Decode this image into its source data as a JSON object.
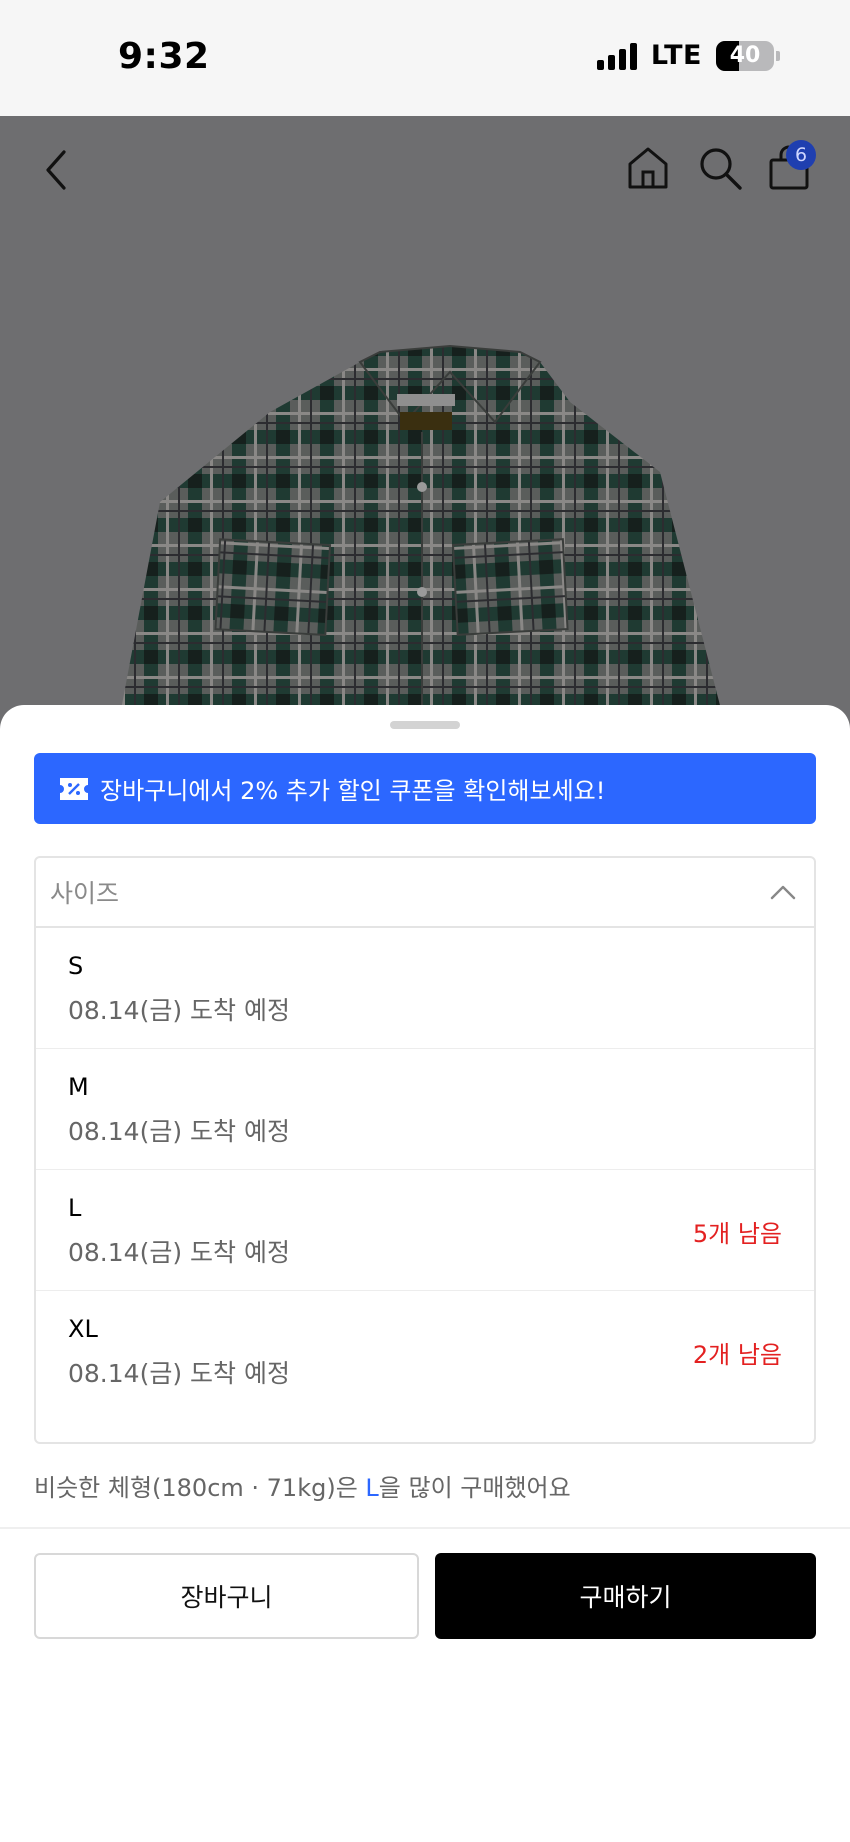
{
  "status": {
    "time": "9:32",
    "network": "LTE",
    "battery": "40",
    "battery_level": 0.4
  },
  "nav": {
    "cart_count": "6"
  },
  "coupon_banner": {
    "text": "장바구니에서 2% 추가 할인 쿠폰을 확인해보세요!",
    "icon": "coupon-icon"
  },
  "size_select": {
    "placeholder": "사이즈",
    "options": [
      {
        "size": "S",
        "arrival": "08.14(금) 도착 예정",
        "stock": ""
      },
      {
        "size": "M",
        "arrival": "08.14(금) 도착 예정",
        "stock": ""
      },
      {
        "size": "L",
        "arrival": "08.14(금) 도착 예정",
        "stock": "5개 남음"
      },
      {
        "size": "XL",
        "arrival": "08.14(금) 도착 예정",
        "stock": "2개 남음"
      }
    ]
  },
  "recommendation": {
    "prefix": "비슷한 체형(180cm · 71kg)은 ",
    "size": "L",
    "suffix": "을 많이 구매했어요"
  },
  "actions": {
    "cart_label": "장바구니",
    "buy_label": "구매하기"
  },
  "colors": {
    "accent_blue": "#2c67ff",
    "stock_red": "#e32121",
    "badge_blue": "#1f3fb0"
  }
}
